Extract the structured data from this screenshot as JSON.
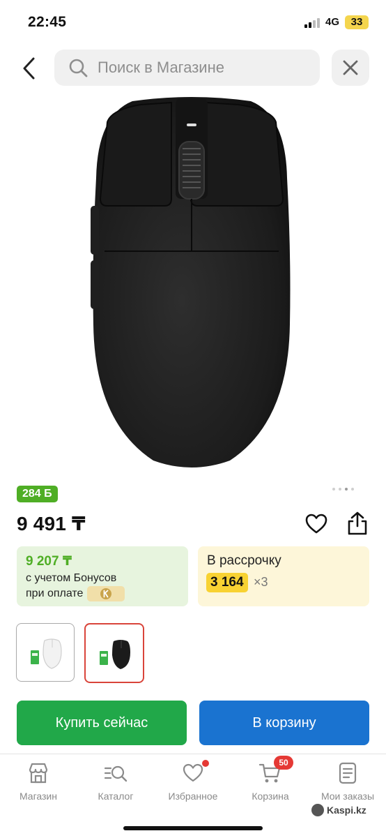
{
  "status_bar": {
    "time": "22:45",
    "network": "4G",
    "battery": "33"
  },
  "header": {
    "search_placeholder": "Поиск в Магазине"
  },
  "product": {
    "bonus_badge": "284 Б",
    "price": "9 491 ₸",
    "bonus_card": {
      "price": "9 207 ₸",
      "line1": "с учетом Бонусов",
      "line2": "при оплате"
    },
    "installment_card": {
      "label": "В рассрочку",
      "amount": "3 164",
      "multiplier": "×3"
    },
    "image_dots": {
      "count": 4,
      "active_index": 2
    },
    "variants": [
      {
        "color": "white",
        "selected": false
      },
      {
        "color": "black",
        "selected": true
      }
    ]
  },
  "actions": {
    "buy_now": "Купить сейчас",
    "add_to_cart": "В корзину"
  },
  "tabbar": {
    "items": [
      {
        "label": "Магазин",
        "icon": "store-icon"
      },
      {
        "label": "Каталог",
        "icon": "catalog-search-icon"
      },
      {
        "label": "Избранное",
        "icon": "heart-icon",
        "dot": true
      },
      {
        "label": "Корзина",
        "icon": "cart-icon",
        "badge": "50"
      },
      {
        "label": "Мои заказы",
        "icon": "orders-icon"
      }
    ]
  },
  "watermark": "Kaspi.kz",
  "colors": {
    "green": "#21a849",
    "blue": "#1a73d0",
    "bonus_green": "#4fae25",
    "installment_yellow": "#f8d232",
    "badge_red": "#e53935"
  }
}
